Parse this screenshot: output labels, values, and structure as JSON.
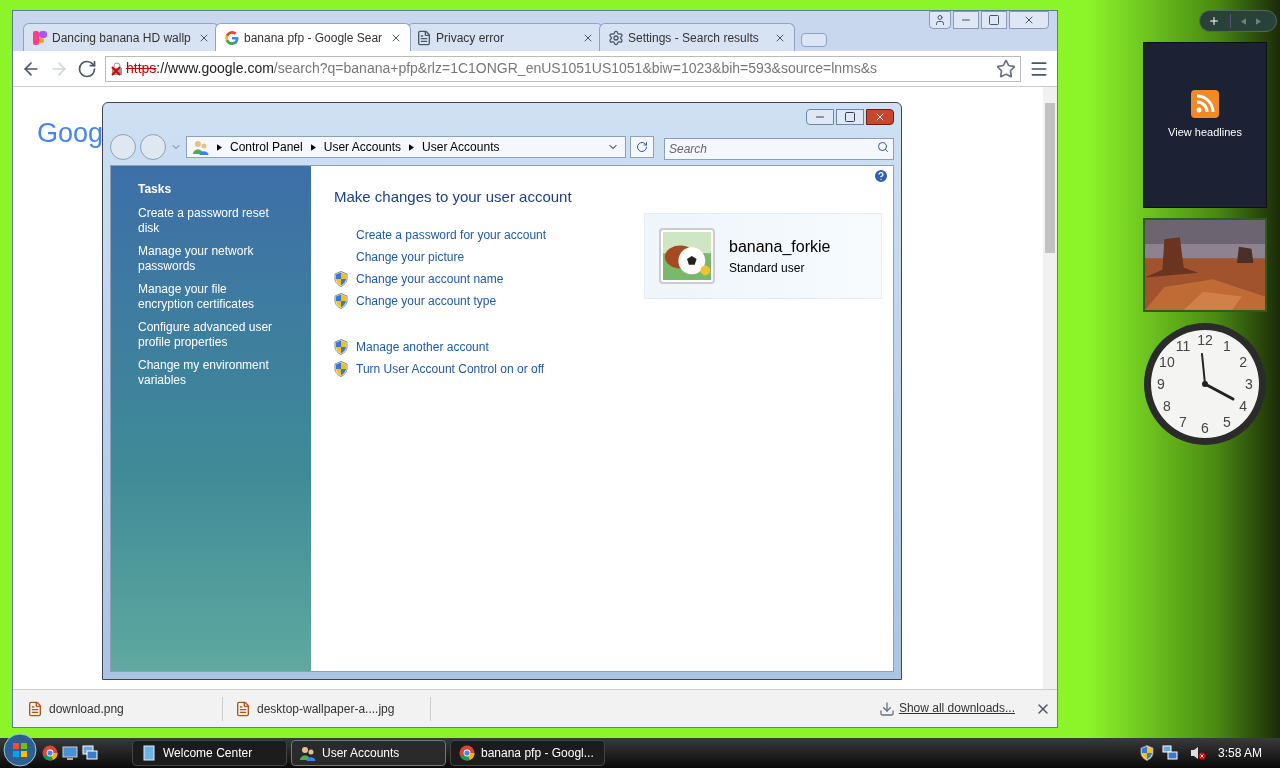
{
  "browser": {
    "tabs": [
      {
        "title": "Dancing banana HD wallp",
        "kind": "logo",
        "selected": false
      },
      {
        "title": "banana pfp - Google Sear",
        "kind": "google",
        "selected": true
      },
      {
        "title": "Privacy error",
        "kind": "page",
        "selected": false
      },
      {
        "title": "Settings - Search results",
        "kind": "gear",
        "selected": false
      }
    ],
    "address": {
      "scheme": "https",
      "host": "://www.google.com",
      "path": "/search?q=banana+pfp&rlz=1C1ONGR_enUS1051US1051&biw=1023&bih=593&source=lnms&s"
    },
    "page_logo": "Goog",
    "downloads": [
      "download.png",
      "desktop-wallpaper-a....jpg"
    ],
    "show_all": "Show all downloads..."
  },
  "control_panel": {
    "breadcrumb": [
      "Control Panel",
      "User Accounts",
      "User Accounts"
    ],
    "search_placeholder": "Search",
    "tasks_title": "Tasks",
    "tasks": [
      "Create a password reset disk",
      "Manage your network passwords",
      "Manage your file encryption certificates",
      "Configure advanced user profile properties",
      "Change my environment variables"
    ],
    "heading": "Make changes to your user account",
    "link_groups": [
      [
        {
          "text": "Create a password for your account",
          "shield": false
        },
        {
          "text": "Change your picture",
          "shield": false
        },
        {
          "text": "Change your account name",
          "shield": true
        },
        {
          "text": "Change your account type",
          "shield": true
        }
      ],
      [
        {
          "text": "Manage another account",
          "shield": true
        },
        {
          "text": "Turn User Account Control on or off",
          "shield": true
        }
      ]
    ],
    "user": {
      "name": "banana_forkie",
      "role": "Standard user"
    }
  },
  "gadgets": {
    "feed_label": "View headlines",
    "clock_numerals": [
      "11",
      "12",
      "1",
      "10",
      "2",
      "9",
      "3",
      "8",
      "4",
      "7",
      "5",
      "6"
    ]
  },
  "taskbar": {
    "buttons": [
      {
        "label": "Welcome Center",
        "kind": "welcome",
        "selected": false
      },
      {
        "label": "User Accounts",
        "kind": "users",
        "selected": true
      },
      {
        "label": "banana pfp - Googl...",
        "kind": "chrome",
        "selected": false
      }
    ],
    "time": "3:58 AM"
  }
}
